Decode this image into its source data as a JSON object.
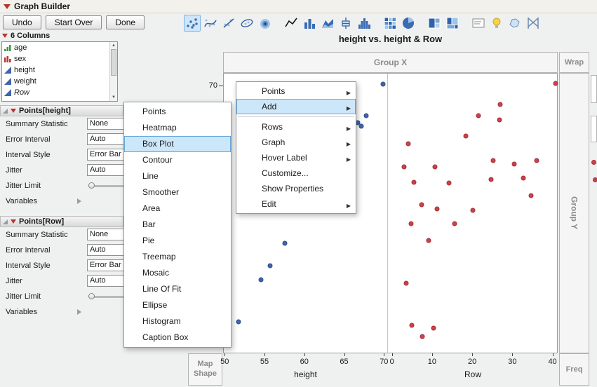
{
  "window": {
    "title": "Graph Builder"
  },
  "buttons": {
    "undo": "Undo",
    "start_over": "Start Over",
    "done": "Done"
  },
  "toolbar": {
    "active_icon": "points",
    "icons": [
      "points",
      "smoother",
      "line-of-fit",
      "ellipse",
      "contour",
      "line",
      "bar-chart",
      "area",
      "box-plot",
      "histogram",
      "heatmap",
      "pie",
      "treemap",
      "mosaic",
      "caption-box",
      "formula",
      "map-shape",
      "parallel-plot"
    ]
  },
  "glyphs": {
    "submenu_arrow": "▶",
    "scroll_up": "▲",
    "scroll_down": "▼"
  },
  "sidebar": {
    "columns_header": "6 Columns",
    "columns": [
      {
        "label": "age"
      },
      {
        "label": "sex"
      },
      {
        "label": "height"
      },
      {
        "label": "weight"
      },
      {
        "label": "Row"
      }
    ],
    "panels": [
      {
        "title": "Points[height]",
        "props": [
          {
            "label": "Summary Statistic",
            "value": "None"
          },
          {
            "label": "Error Interval",
            "value": "Auto"
          },
          {
            "label": "Interval Style",
            "value": "Error Bar"
          },
          {
            "label": "Jitter",
            "value": "Auto"
          },
          {
            "label": "Jitter Limit",
            "value": ""
          },
          {
            "label": "Variables",
            "value": ""
          }
        ]
      },
      {
        "title": "Points[Row]",
        "props": [
          {
            "label": "Summary Statistic",
            "value": "None"
          },
          {
            "label": "Error Interval",
            "value": "Auto"
          },
          {
            "label": "Interval Style",
            "value": "Error Bar"
          },
          {
            "label": "Jitter",
            "value": "Auto"
          },
          {
            "label": "Jitter Limit",
            "value": ""
          },
          {
            "label": "Variables",
            "value": ""
          }
        ]
      }
    ]
  },
  "chart_zones": {
    "group_x": "Group X",
    "group_y": "Group Y",
    "wrap": "Wrap",
    "freq": "Freq",
    "map_shape": "Map Shape"
  },
  "chart_data": {
    "type": "scatter",
    "title": "height vs. height & Row",
    "ylim": [
      50.2,
      70.8
    ],
    "y_ticks_visible": [
      70
    ],
    "panels": [
      {
        "xlabel": "height",
        "xlim": [
          49.8,
          70.5
        ],
        "ticks": [
          50,
          55,
          60,
          65,
          70
        ],
        "series": "height",
        "color": "#3f66ad",
        "points": [
          [
            70.0,
            70.0
          ],
          [
            67.8,
            67.7
          ],
          [
            67.2,
            66.9
          ],
          [
            66.8,
            67.2
          ],
          [
            57.5,
            58.3
          ],
          [
            55.7,
            56.6
          ],
          [
            54.5,
            55.6
          ],
          [
            51.7,
            52.5
          ]
        ]
      },
      {
        "xlabel": "Row",
        "xlim": [
          -1,
          41.3
        ],
        "ticks": [
          0,
          10,
          20,
          30,
          40
        ],
        "series": "Row",
        "color": "#cf4048",
        "points": [
          [
            40.9,
            70.1
          ],
          [
            27.1,
            68.5
          ],
          [
            21.5,
            67.7
          ],
          [
            26.8,
            67.4
          ],
          [
            18.4,
            66.2
          ],
          [
            3.9,
            65.6
          ],
          [
            2.8,
            63.9
          ],
          [
            10.7,
            63.9
          ],
          [
            25.2,
            64.4
          ],
          [
            30.5,
            64.1
          ],
          [
            36.2,
            64.4
          ],
          [
            5.3,
            62.8
          ],
          [
            14.2,
            62.7
          ],
          [
            24.7,
            63.0
          ],
          [
            32.9,
            63.1
          ],
          [
            34.8,
            61.8
          ],
          [
            7.2,
            61.1
          ],
          [
            11.1,
            60.8
          ],
          [
            4.6,
            59.7
          ],
          [
            15.6,
            59.7
          ],
          [
            20.1,
            60.7
          ],
          [
            9.0,
            58.5
          ],
          [
            3.4,
            55.3
          ],
          [
            4.8,
            52.2
          ],
          [
            7.4,
            51.4
          ],
          [
            10.2,
            52.0
          ]
        ]
      }
    ]
  },
  "menus": {
    "element_menu": {
      "highlighted": "Box Plot",
      "items": [
        "Points",
        "Heatmap",
        "Box Plot",
        "Contour",
        "Line",
        "Smoother",
        "Area",
        "Bar",
        "Pie",
        "Treemap",
        "Mosaic",
        "Line Of Fit",
        "Ellipse",
        "Histogram",
        "Caption Box"
      ]
    },
    "context_menu": {
      "highlighted": "Add",
      "items": [
        {
          "label": "Points",
          "has_submenu": true
        },
        {
          "label": "Add",
          "has_submenu": true
        },
        {
          "label": "Rows",
          "has_submenu": true
        },
        {
          "label": "Graph",
          "has_submenu": true
        },
        {
          "label": "Hover Label",
          "has_submenu": true
        },
        {
          "label": "Customize...",
          "has_submenu": false
        },
        {
          "label": "Show Properties",
          "has_submenu": false
        },
        {
          "label": "Edit",
          "has_submenu": true
        }
      ]
    }
  }
}
